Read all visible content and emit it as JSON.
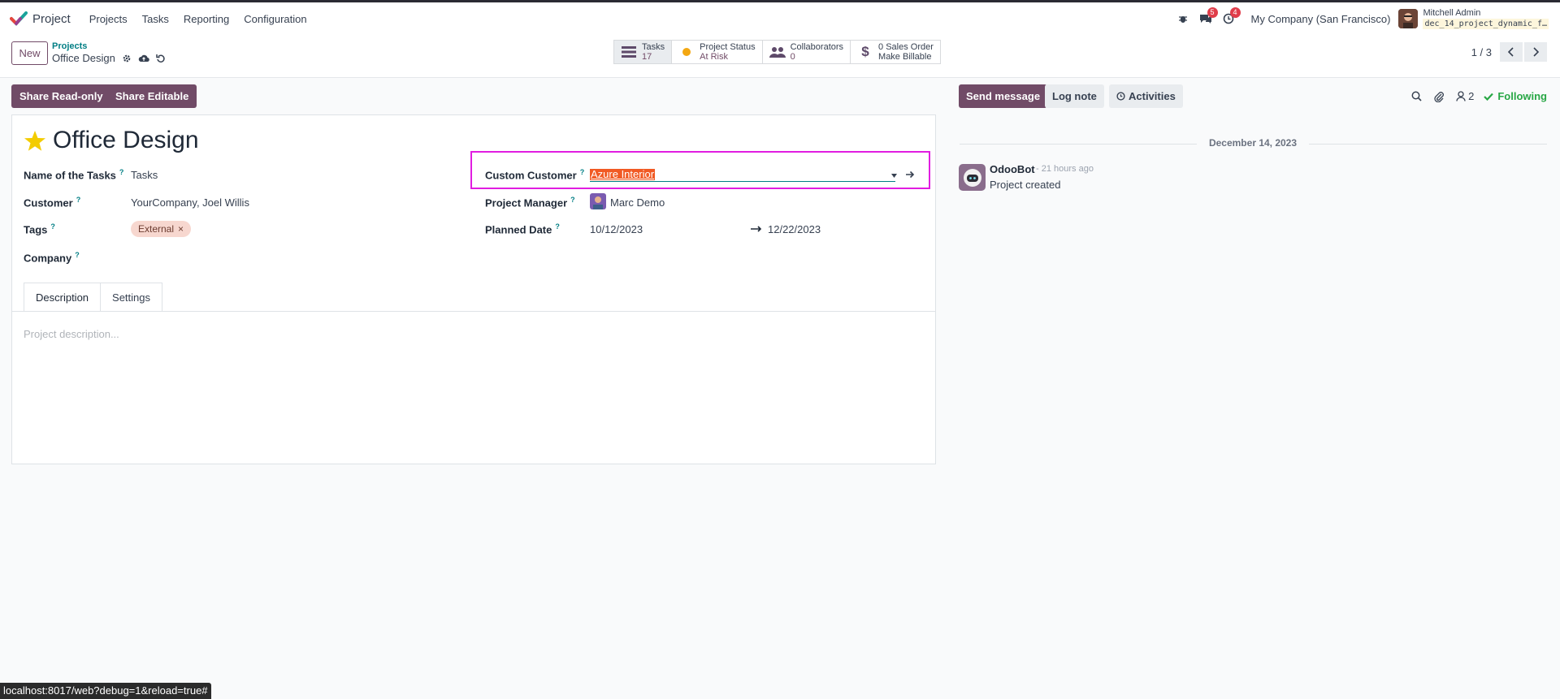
{
  "navbar": {
    "app_name": "Project",
    "menu": [
      "Projects",
      "Tasks",
      "Reporting",
      "Configuration"
    ],
    "messages_count": "5",
    "activities_count": "4",
    "company": "My Company (San Francisco)",
    "user_name": "Mitchell Admin",
    "db_name": "dec_14_project_dynamic_f…"
  },
  "control": {
    "new_label": "New",
    "breadcrumb_parent": "Projects",
    "breadcrumb_current": "Office Design",
    "smart_buttons": [
      {
        "label": "Tasks",
        "value": "17",
        "icon": "tasks-icon"
      },
      {
        "label": "Project Status",
        "value": "At Risk",
        "icon": "status-dot-icon",
        "color": "#f3a712"
      },
      {
        "label": "Collaborators",
        "value": "0",
        "icon": "users-icon"
      },
      {
        "label": "0 Sales Order",
        "value": "Make Billable",
        "icon": "dollar-icon"
      }
    ],
    "pager": "1 / 3"
  },
  "actions": {
    "share_readonly": "Share Read-only",
    "share_editable": "Share Editable"
  },
  "form": {
    "title": "Office Design",
    "fields": {
      "name_of_tasks_label": "Name of the Tasks",
      "name_of_tasks_value": "Tasks",
      "customer_label": "Customer",
      "customer_value": "YourCompany, Joel Willis",
      "tags_label": "Tags",
      "tag_external": "External",
      "company_label": "Company",
      "custom_customer_label": "Custom Customer",
      "custom_customer_value": "Azure Interior",
      "project_manager_label": "Project Manager",
      "project_manager_value": "Marc Demo",
      "planned_date_label": "Planned Date",
      "planned_date_start": "10/12/2023",
      "planned_date_end": "12/22/2023"
    },
    "help_mark": "?",
    "tabs": [
      "Description",
      "Settings"
    ],
    "description_placeholder": "Project description..."
  },
  "chatter": {
    "send_message": "Send message",
    "log_note": "Log note",
    "activities": "Activities",
    "followers_count": "2",
    "following": "Following",
    "date_separator": "December 14, 2023",
    "message": {
      "author": "OdooBot",
      "time": "- 21 hours ago",
      "body": "Project created"
    }
  },
  "status_bar": "localhost:8017/web?debug=1&reload=true#",
  "colors": {
    "primary": "#714b67",
    "accent": "#017e84",
    "highlight_box": "#e11de1",
    "following": "#28a745"
  }
}
